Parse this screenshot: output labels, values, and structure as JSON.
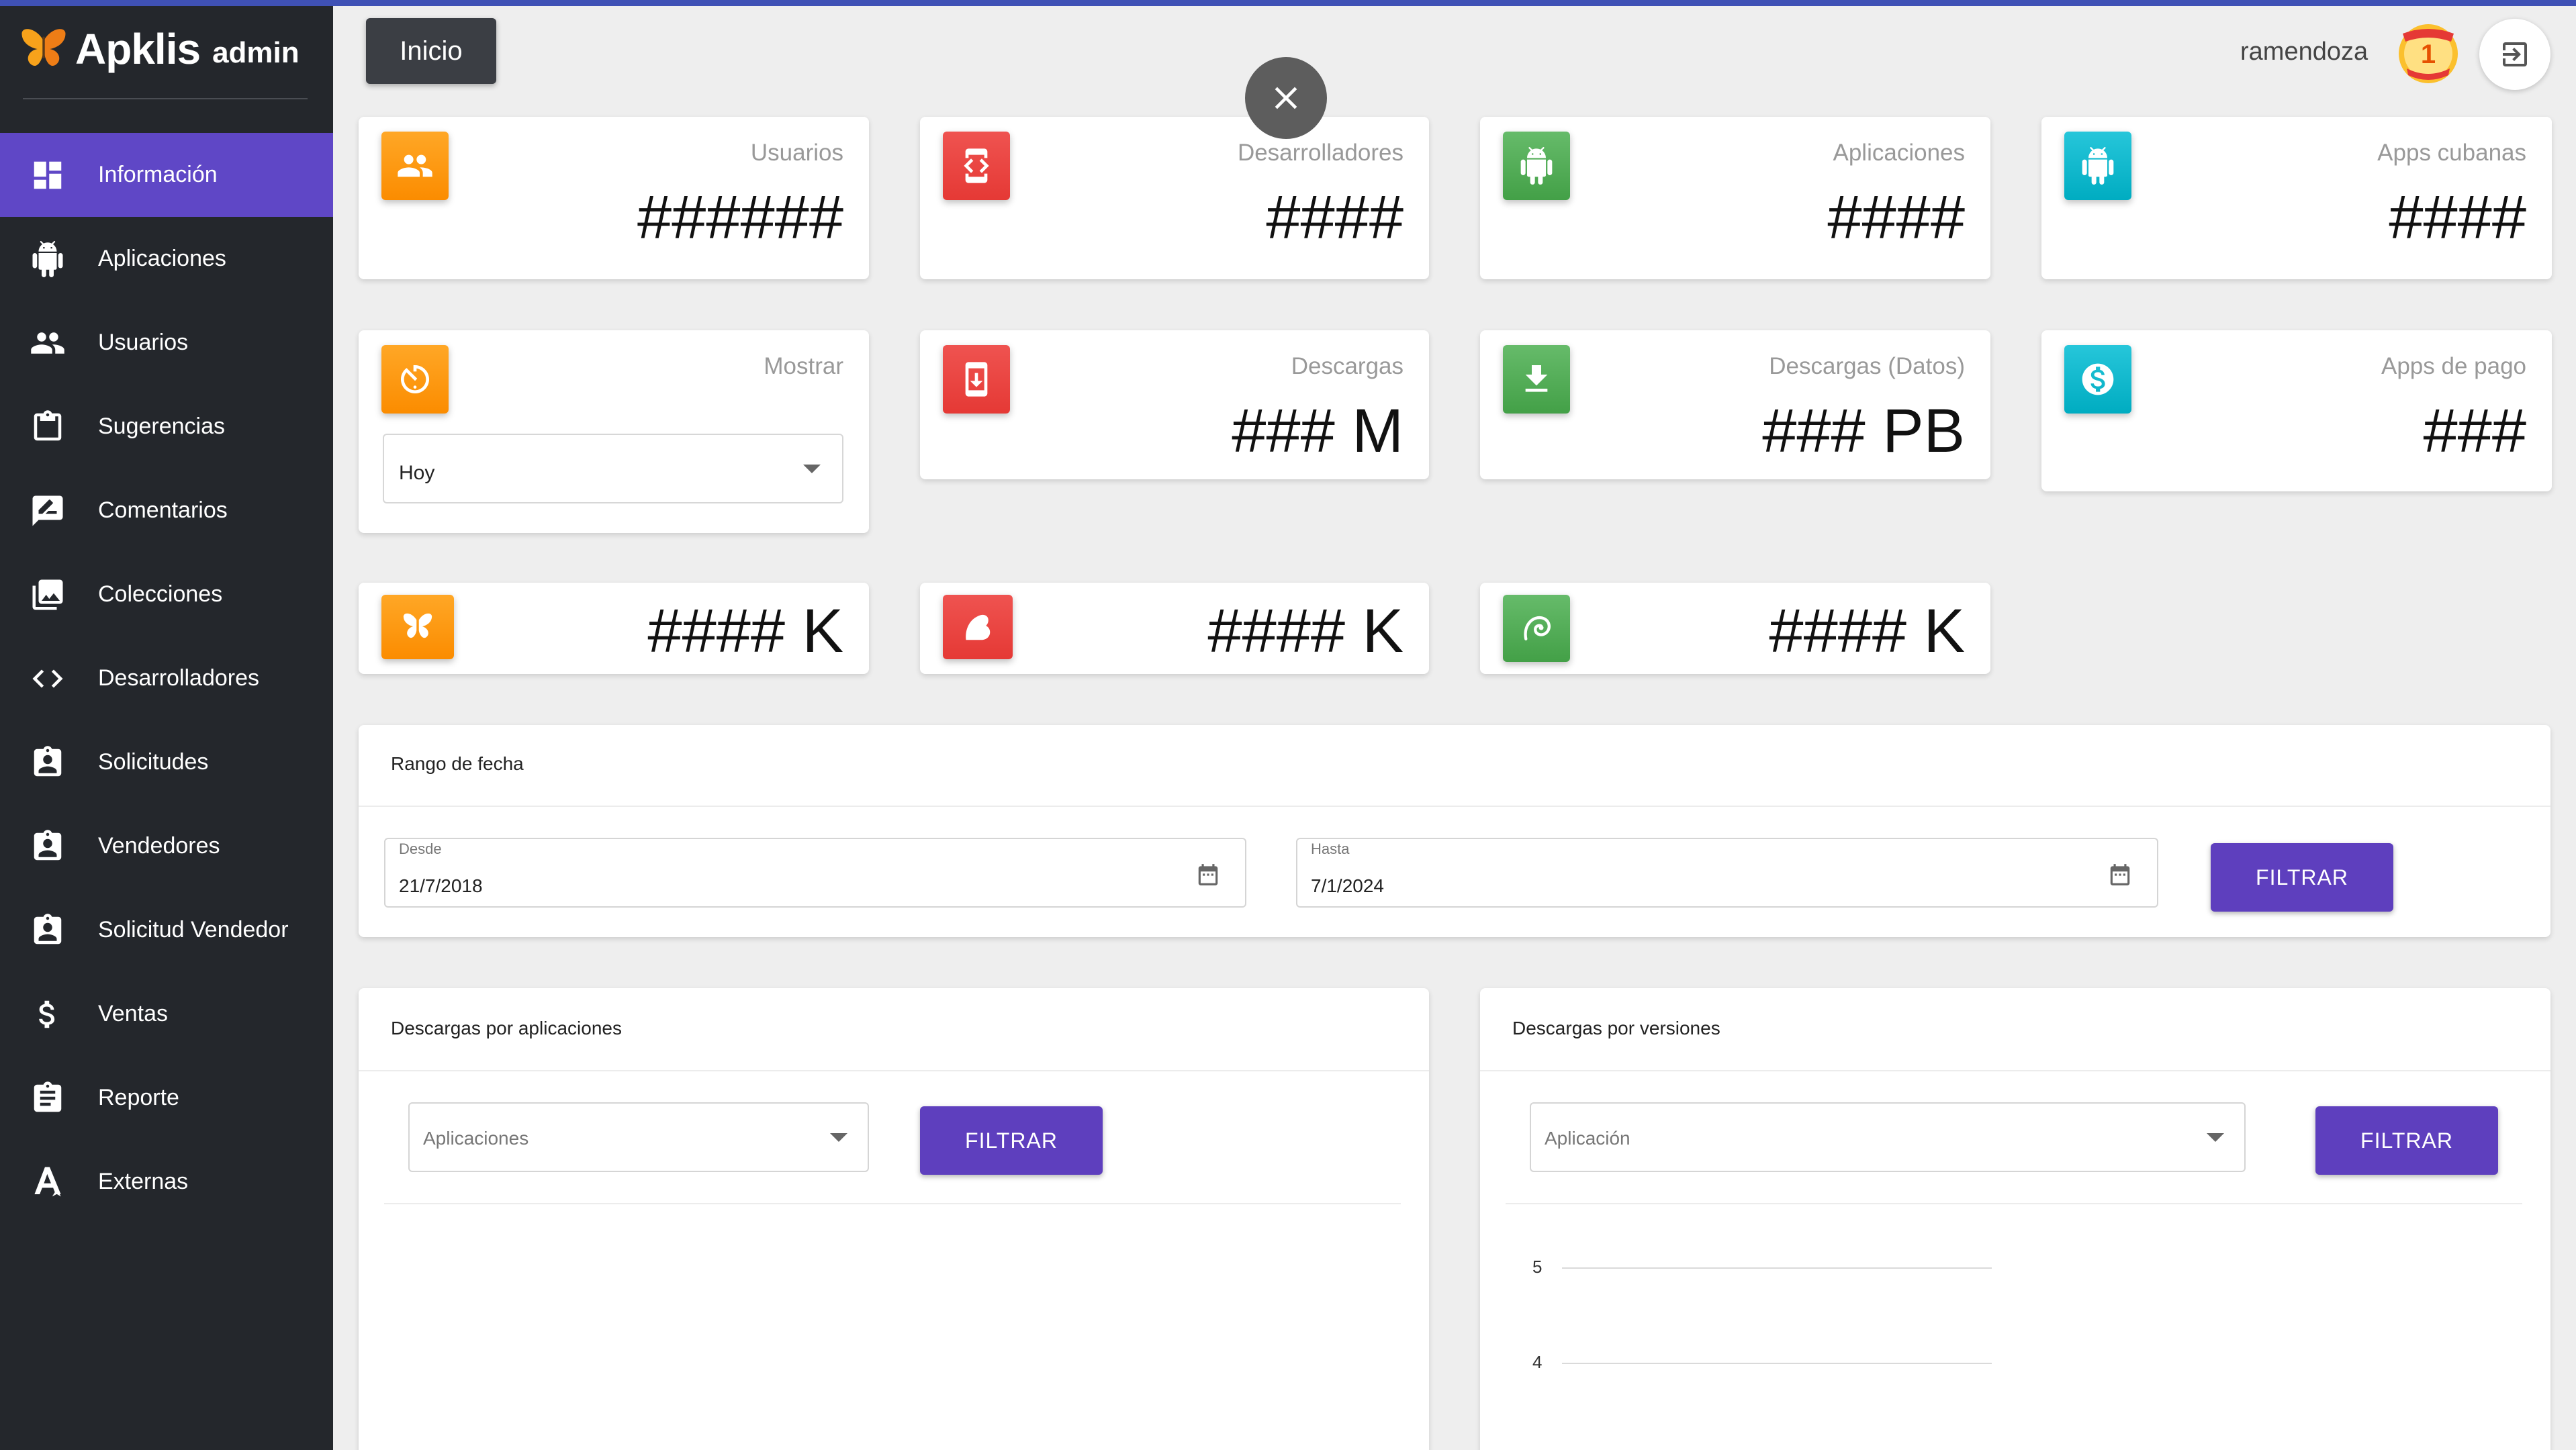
{
  "brand": {
    "name": "Apklis",
    "suffix": "admin"
  },
  "sidebar": {
    "items": [
      {
        "label": "Información",
        "icon": "dashboard-icon",
        "active": true
      },
      {
        "label": "Aplicaciones",
        "icon": "android-icon"
      },
      {
        "label": "Usuarios",
        "icon": "people-icon"
      },
      {
        "label": "Sugerencias",
        "icon": "clipboard-icon"
      },
      {
        "label": "Comentarios",
        "icon": "rate-review-icon"
      },
      {
        "label": "Colecciones",
        "icon": "photo-library-icon"
      },
      {
        "label": "Desarrolladores",
        "icon": "code-icon"
      },
      {
        "label": "Solicitudes",
        "icon": "assignment-ind-icon"
      },
      {
        "label": "Vendedores",
        "icon": "assignment-ind-icon"
      },
      {
        "label": "Solicitud Vendedor",
        "icon": "assignment-ind-icon"
      },
      {
        "label": "Ventas",
        "icon": "dollar-icon"
      },
      {
        "label": "Reporte",
        "icon": "assignment-icon"
      },
      {
        "label": "Externas",
        "icon": "external-a-icon"
      }
    ]
  },
  "header": {
    "home_label": "Inicio",
    "username": "ramendoza",
    "badge_number": "1"
  },
  "stats": {
    "usuarios": {
      "label": "Usuarios",
      "value": "######"
    },
    "desarrolladores": {
      "label": "Desarrolladores",
      "value": "####"
    },
    "aplicaciones": {
      "label": "Aplicaciones",
      "value": "####"
    },
    "apps_cubanas": {
      "label": "Apps cubanas",
      "value": "####"
    },
    "mostrar": {
      "label": "Mostrar",
      "selected": "Hoy"
    },
    "descargas": {
      "label": "Descargas",
      "value": "### M"
    },
    "descargas_datos": {
      "label": "Descargas (Datos)",
      "value": "### PB"
    },
    "apps_pago": {
      "label": "Apps de pago",
      "value": "###"
    },
    "brand_a": {
      "value": "#### K"
    },
    "brand_b": {
      "value": "#### K"
    },
    "brand_c": {
      "value": "#### K"
    }
  },
  "date_range": {
    "title": "Rango de fecha",
    "from_label": "Desde",
    "from_value": "21/7/2018",
    "to_label": "Hasta",
    "to_value": "7/1/2024",
    "filter_label": "FILTRAR"
  },
  "downloads_by_app": {
    "title": "Descargas por aplicaciones",
    "select_placeholder": "Aplicaciones",
    "filter_label": "FILTRAR"
  },
  "downloads_by_version": {
    "title": "Descargas por versiones",
    "select_placeholder": "Aplicación",
    "filter_label": "FILTRAR",
    "y_ticks": [
      "5",
      "4"
    ]
  },
  "colors": {
    "accent": "#5f47c6",
    "sidebar_bg": "#24272c",
    "orange": "#fb8c00",
    "red": "#e53935",
    "green": "#43a047",
    "cyan": "#00acc1"
  }
}
